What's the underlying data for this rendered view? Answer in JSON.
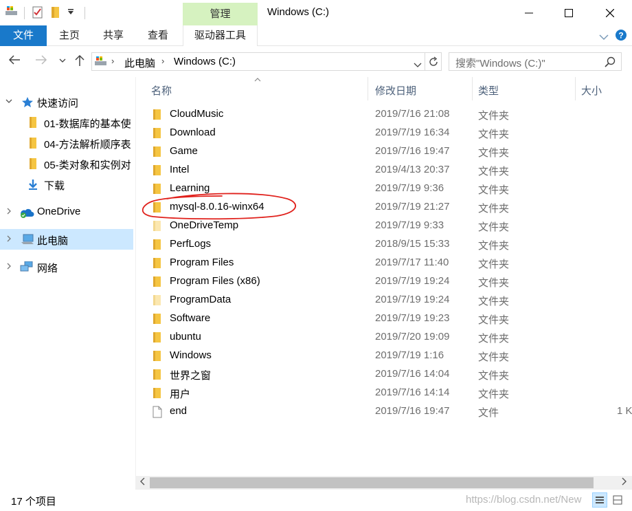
{
  "window": {
    "title": "Windows (C:)",
    "context_tab_header": "管理"
  },
  "ribbon": {
    "file_tab": "文件",
    "tabs": [
      "主页",
      "共享",
      "查看"
    ],
    "context_tab": "驱动器工具"
  },
  "address": {
    "crumbs": [
      "此电脑",
      "Windows (C:)"
    ],
    "search_placeholder": "搜索\"Windows (C:)\""
  },
  "nav": {
    "quick_access": "快速访问",
    "quick_items": [
      "01-数据库的基本使",
      "04-方法解析顺序表",
      "05-类对象和实例对"
    ],
    "downloads": "下载",
    "onedrive": "OneDrive",
    "this_pc": "此电脑",
    "network": "网络"
  },
  "columns": {
    "name": "名称",
    "modified": "修改日期",
    "type": "类型",
    "size": "大小"
  },
  "files": [
    {
      "name": "CloudMusic",
      "date": "2019/7/16 21:08",
      "type": "文件夹",
      "size": "",
      "icon": "folder-icon"
    },
    {
      "name": "Download",
      "date": "2019/7/19 16:34",
      "type": "文件夹",
      "size": "",
      "icon": "folder-icon"
    },
    {
      "name": "Game",
      "date": "2019/7/16 19:47",
      "type": "文件夹",
      "size": "",
      "icon": "folder-icon"
    },
    {
      "name": "Intel",
      "date": "2019/4/13 20:37",
      "type": "文件夹",
      "size": "",
      "icon": "folder-icon"
    },
    {
      "name": "Learning",
      "date": "2019/7/19 9:36",
      "type": "文件夹",
      "size": "",
      "icon": "folder-icon"
    },
    {
      "name": "mysql-8.0.16-winx64",
      "date": "2019/7/19 21:27",
      "type": "文件夹",
      "size": "",
      "icon": "folder-icon"
    },
    {
      "name": "OneDriveTemp",
      "date": "2019/7/19 9:33",
      "type": "文件夹",
      "size": "",
      "icon": "faded-folder-icon"
    },
    {
      "name": "PerfLogs",
      "date": "2018/9/15 15:33",
      "type": "文件夹",
      "size": "",
      "icon": "folder-icon"
    },
    {
      "name": "Program Files",
      "date": "2019/7/17 11:40",
      "type": "文件夹",
      "size": "",
      "icon": "folder-icon"
    },
    {
      "name": "Program Files (x86)",
      "date": "2019/7/19 19:24",
      "type": "文件夹",
      "size": "",
      "icon": "folder-icon"
    },
    {
      "name": "ProgramData",
      "date": "2019/7/19 19:24",
      "type": "文件夹",
      "size": "",
      "icon": "faded-folder-icon"
    },
    {
      "name": "Software",
      "date": "2019/7/19 19:23",
      "type": "文件夹",
      "size": "",
      "icon": "folder-icon"
    },
    {
      "name": "ubuntu",
      "date": "2019/7/20 19:09",
      "type": "文件夹",
      "size": "",
      "icon": "folder-icon"
    },
    {
      "name": "Windows",
      "date": "2019/7/19 1:16",
      "type": "文件夹",
      "size": "",
      "icon": "folder-icon"
    },
    {
      "name": "世界之窗",
      "date": "2019/7/16 14:04",
      "type": "文件夹",
      "size": "",
      "icon": "folder-icon"
    },
    {
      "name": "用户",
      "date": "2019/7/16 14:14",
      "type": "文件夹",
      "size": "",
      "icon": "folder-icon"
    },
    {
      "name": "end",
      "date": "2019/7/16 19:47",
      "type": "文件",
      "size": "1 K",
      "icon": "file-icon"
    }
  ],
  "status": {
    "item_count": "17 个项目",
    "watermark": "https://blog.csdn.net/New"
  },
  "colors": {
    "accent": "#1979ca",
    "selection": "#cce8ff",
    "context_tab": "#d6f2c0",
    "folder": "#f5c542",
    "annotation": "#e0201b"
  }
}
